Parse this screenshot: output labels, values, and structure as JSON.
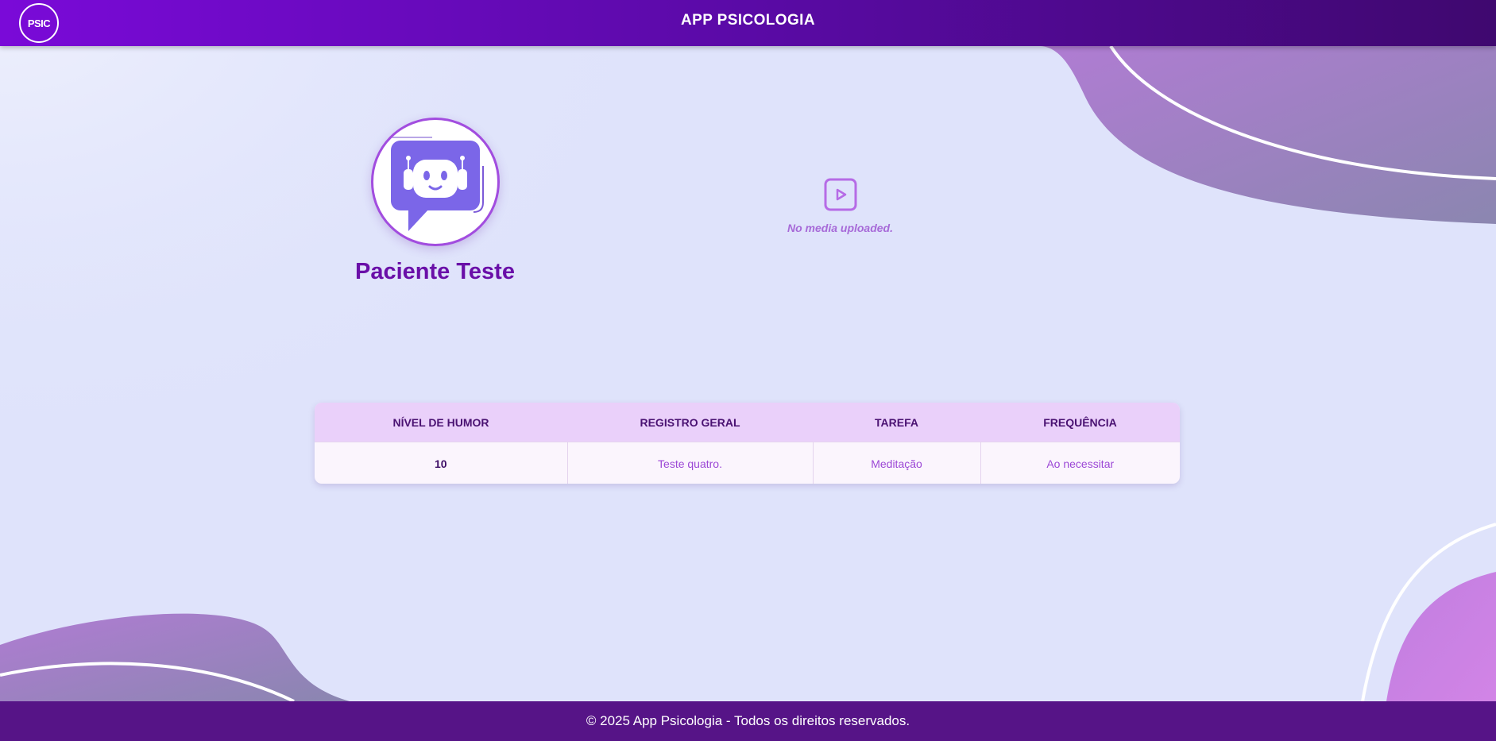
{
  "header": {
    "logo_text": "PSIC",
    "title": "APP PSICOLOGIA"
  },
  "profile": {
    "name": "Paciente Teste",
    "avatar_icon": "robot-chat-icon"
  },
  "media": {
    "icon": "play-video-icon",
    "empty_text": "No media uploaded."
  },
  "table": {
    "headers": [
      "NÍVEL DE HUMOR",
      "REGISTRO GERAL",
      "TAREFA",
      "FREQUÊNCIA"
    ],
    "rows": [
      [
        "10",
        "Teste quatro.",
        "Meditação",
        "Ao necessitar"
      ]
    ]
  },
  "footer": {
    "text": "© 2025 App Psicologia - Todos os direitos reservados."
  },
  "colors": {
    "header_start": "#7a0ad8",
    "header_end": "#3f086f",
    "footer": "#561487",
    "accent": "#a24ddf",
    "background": "#dfe3fb"
  }
}
